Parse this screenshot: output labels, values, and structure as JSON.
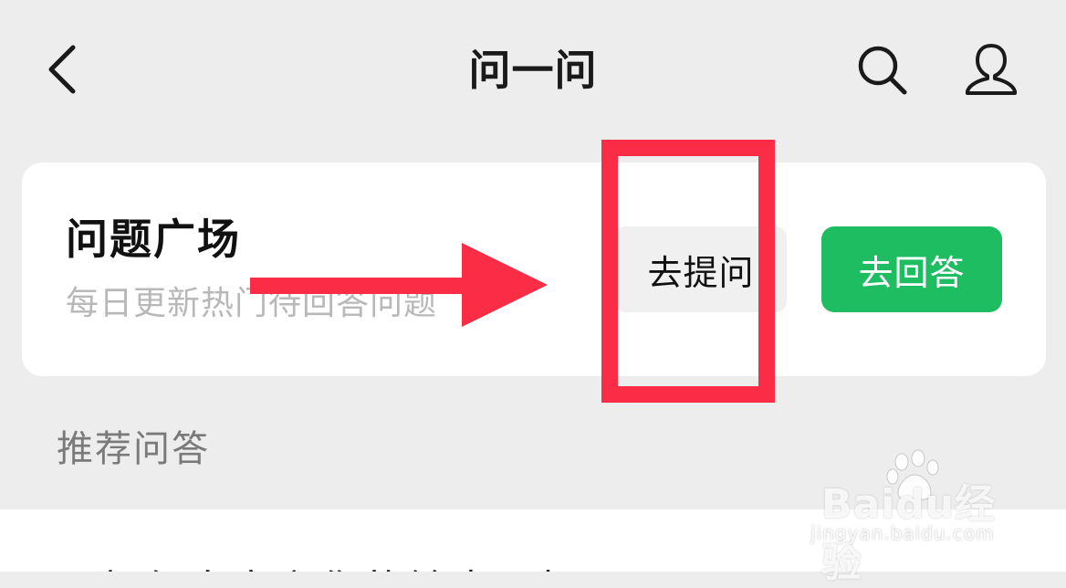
{
  "header": {
    "title": "问一问",
    "back_icon": "chevron-left-icon",
    "search_icon": "search-icon",
    "profile_icon": "user-icon"
  },
  "plaza": {
    "title": "问题广场",
    "subtitle": "每日更新热门待回答问题",
    "ask_label": "去提问",
    "answer_label": "去回答",
    "answer_color": "#1fbd61"
  },
  "section": {
    "title": "推荐问答"
  },
  "list": {
    "peek_text": "如何自定义你的铃声图标"
  },
  "annotation": {
    "color": "#fb2d46"
  },
  "watermark": {
    "brand": "Baidu经验",
    "url": "jingyan.baidu.com"
  }
}
